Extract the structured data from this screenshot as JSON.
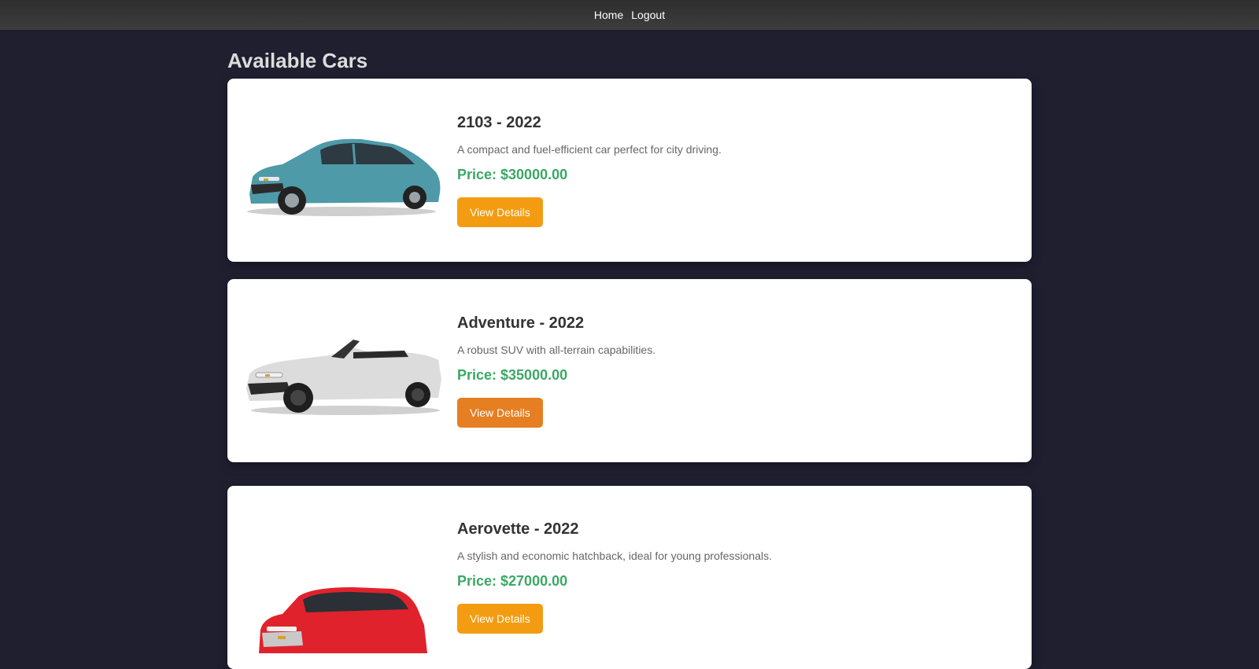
{
  "nav": {
    "home": "Home",
    "logout": "Logout"
  },
  "page": {
    "title": "Available Cars"
  },
  "cars": [
    {
      "title": "2103 - 2022",
      "description": "A compact and fuel-efficient car perfect for city driving.",
      "price": "Price: $30000.00",
      "button": "View Details",
      "button_color": "#f39c12",
      "car_color": "#4e9aa8",
      "image_icon": "sedan-car-icon"
    },
    {
      "title": "Adventure - 2022",
      "description": "A robust SUV with all-terrain capabilities.",
      "price": "Price: $35000.00",
      "button": "View Details",
      "button_color": "#e67e22",
      "car_color": "#d9d9d9",
      "image_icon": "convertible-car-icon"
    },
    {
      "title": "Aerovette - 2022",
      "description": "A stylish and economic hatchback, ideal for young professionals.",
      "price": "Price: $27000.00",
      "button": "View Details",
      "button_color": "#f39c12",
      "car_color": "#e0222c",
      "image_icon": "suv-car-icon"
    }
  ],
  "colors": {
    "background": "#1f1f30",
    "navbar": "#383838",
    "price": "#3aa864"
  }
}
